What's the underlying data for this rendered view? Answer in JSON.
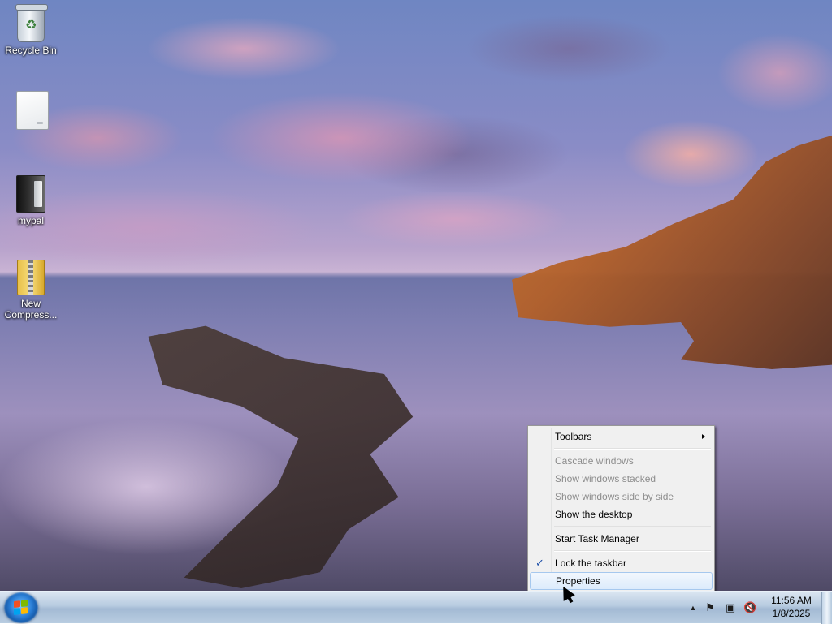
{
  "desktop": {
    "icons": [
      {
        "label": "Recycle Bin",
        "icon": "recycle-bin-icon"
      },
      {
        "label": "",
        "icon": "blank-file-icon"
      },
      {
        "label": "mypal",
        "icon": "mypal-app-icon"
      },
      {
        "label": "New Compress...",
        "icon": "compressed-folder-icon"
      }
    ]
  },
  "context_menu": {
    "toolbars": "Toolbars",
    "cascade": "Cascade windows",
    "stacked": "Show windows stacked",
    "side_by_side": "Show windows side by side",
    "show_desktop": "Show the desktop",
    "task_manager": "Start Task Manager",
    "lock_taskbar": "Lock the taskbar",
    "lock_checked": true,
    "check_glyph": "✓",
    "properties": "Properties",
    "highlighted": "Properties"
  },
  "taskbar": {
    "start_icon": "windows-start-icon",
    "tray": {
      "show_hidden_glyph": "▲",
      "flag_glyph": "⚑",
      "network_glyph": "▣",
      "volume_glyph": "🔇"
    },
    "clock": {
      "time": "11:56 AM",
      "date": "1/8/2025"
    }
  },
  "colors": {
    "menu_highlight_border": "#a6c8ee",
    "menu_disabled_text": "#8d8d8d",
    "check_color": "#1c4ea8"
  }
}
